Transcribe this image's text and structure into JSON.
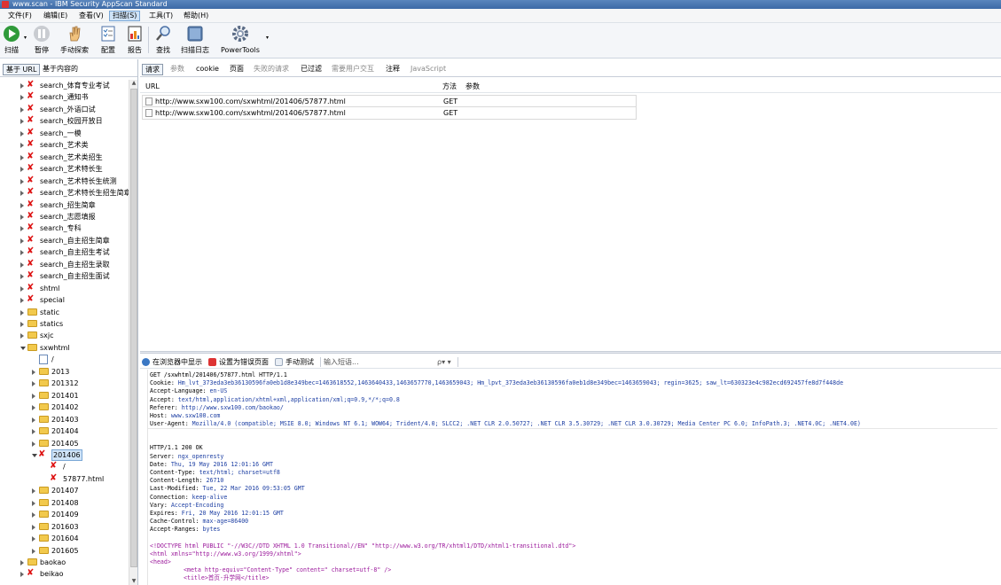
{
  "window": {
    "title": "www.scan - IBM Security AppScan Standard"
  },
  "menu": [
    "文件(F)",
    "编辑(E)",
    "查看(V)",
    "扫描(S)",
    "工具(T)",
    "帮助(H)"
  ],
  "toolbar": {
    "scan": "扫描",
    "pause": "暂停",
    "manual": "手动探索",
    "config": "配置",
    "report": "报告",
    "find": "查找",
    "log": "扫描日志",
    "powertools": "PowerTools"
  },
  "left_tabs": [
    "基于 URL",
    "基于内容的"
  ],
  "tree": [
    {
      "label": "search_体育专业考试",
      "icon": "bad",
      "exp": "closed",
      "indent": 1
    },
    {
      "label": "search_通知书",
      "icon": "bad",
      "exp": "closed",
      "indent": 1
    },
    {
      "label": "search_外语口试",
      "icon": "bad",
      "exp": "closed",
      "indent": 1
    },
    {
      "label": "search_校园开放日",
      "icon": "bad",
      "exp": "closed",
      "indent": 1
    },
    {
      "label": "search_一模",
      "icon": "bad",
      "exp": "closed",
      "indent": 1
    },
    {
      "label": "search_艺术类",
      "icon": "bad",
      "exp": "closed",
      "indent": 1
    },
    {
      "label": "search_艺术类招生",
      "icon": "bad",
      "exp": "closed",
      "indent": 1
    },
    {
      "label": "search_艺术特长生",
      "icon": "bad",
      "exp": "closed",
      "indent": 1
    },
    {
      "label": "search_艺术特长生统测",
      "icon": "bad",
      "exp": "closed",
      "indent": 1
    },
    {
      "label": "search_艺术特长生招生简章",
      "icon": "bad",
      "exp": "closed",
      "indent": 1
    },
    {
      "label": "search_招生简章",
      "icon": "bad",
      "exp": "closed",
      "indent": 1
    },
    {
      "label": "search_志愿填报",
      "icon": "bad",
      "exp": "closed",
      "indent": 1
    },
    {
      "label": "search_专科",
      "icon": "bad",
      "exp": "closed",
      "indent": 1
    },
    {
      "label": "search_自主招生简章",
      "icon": "bad",
      "exp": "closed",
      "indent": 1
    },
    {
      "label": "search_自主招生考试",
      "icon": "bad",
      "exp": "closed",
      "indent": 1
    },
    {
      "label": "search_自主招生录取",
      "icon": "bad",
      "exp": "closed",
      "indent": 1
    },
    {
      "label": "search_自主招生面试",
      "icon": "bad",
      "exp": "closed",
      "indent": 1
    },
    {
      "label": "shtml",
      "icon": "bad",
      "exp": "closed",
      "indent": 1
    },
    {
      "label": "special",
      "icon": "bad",
      "exp": "closed",
      "indent": 1
    },
    {
      "label": "static",
      "icon": "folder",
      "exp": "closed",
      "indent": 1
    },
    {
      "label": "statics",
      "icon": "folder",
      "exp": "closed",
      "indent": 1
    },
    {
      "label": "sxjc",
      "icon": "folder",
      "exp": "closed",
      "indent": 1
    },
    {
      "label": "sxwhtml",
      "icon": "folder",
      "exp": "open",
      "indent": 1
    },
    {
      "label": "/",
      "icon": "page",
      "exp": "none",
      "indent": 2
    },
    {
      "label": "2013",
      "icon": "folder",
      "exp": "closed",
      "indent": 2
    },
    {
      "label": "201312",
      "icon": "folder",
      "exp": "closed",
      "indent": 2
    },
    {
      "label": "201401",
      "icon": "folder",
      "exp": "closed",
      "indent": 2
    },
    {
      "label": "201402",
      "icon": "folder",
      "exp": "closed",
      "indent": 2
    },
    {
      "label": "201403",
      "icon": "folder",
      "exp": "closed",
      "indent": 2
    },
    {
      "label": "201404",
      "icon": "folder",
      "exp": "closed",
      "indent": 2
    },
    {
      "label": "201405",
      "icon": "folder",
      "exp": "closed",
      "indent": 2
    },
    {
      "label": "201406",
      "icon": "bad",
      "exp": "open",
      "indent": 2,
      "selected": true
    },
    {
      "label": "/",
      "icon": "bad",
      "exp": "none",
      "indent": 3
    },
    {
      "label": "57877.html",
      "icon": "bad",
      "exp": "none",
      "indent": 3
    },
    {
      "label": "201407",
      "icon": "folder",
      "exp": "closed",
      "indent": 2
    },
    {
      "label": "201408",
      "icon": "folder",
      "exp": "closed",
      "indent": 2
    },
    {
      "label": "201409",
      "icon": "folder",
      "exp": "closed",
      "indent": 2
    },
    {
      "label": "201603",
      "icon": "folder",
      "exp": "closed",
      "indent": 2
    },
    {
      "label": "201604",
      "icon": "folder",
      "exp": "closed",
      "indent": 2
    },
    {
      "label": "201605",
      "icon": "folder",
      "exp": "closed",
      "indent": 2
    },
    {
      "label": "baokao",
      "icon": "folder",
      "exp": "closed",
      "indent": 1
    },
    {
      "label": "beikao",
      "icon": "bad",
      "exp": "closed",
      "indent": 1
    }
  ],
  "right_tabs": [
    {
      "label": "请求",
      "selected": true
    },
    {
      "label": "参数",
      "dim": true
    },
    {
      "label": "cookie"
    },
    {
      "label": "页面"
    },
    {
      "label": "失败的请求",
      "dim": true
    },
    {
      "label": "已过滤"
    },
    {
      "label": "需要用户交互",
      "dim": true
    },
    {
      "label": "注释"
    },
    {
      "label": "JavaScript",
      "dim": true
    }
  ],
  "table": {
    "headers": [
      "URL",
      "方法",
      "参数"
    ],
    "rows": [
      {
        "url": "http://www.sxw100.com/sxwhtml/201406/57877.html",
        "method": "GET"
      },
      {
        "url": "http://www.sxw100.com/sxwhtml/201406/57877.html",
        "method": "GET"
      }
    ]
  },
  "detail_toolbar": {
    "show_browser": "在浏览器中显示",
    "set_error": "设置为错误页面",
    "manual_test": "手动测试",
    "search_placeholder": "输入短语...",
    "search_icon": "ρ▾ ▾"
  },
  "request_lines": [
    {
      "k": "GET /sxwhtml/201406/57877.html HTTP/1.1",
      "v": ""
    },
    {
      "k": "Cookie: ",
      "v": "Hm_lvt_373eda3eb36130596fa0eb1d8e349bec=1463618552,1463640433,1463657770,1463659043; Hm_lpvt_373eda3eb36130596fa0eb1d8e349bec=1463659043; regin=3625; saw_lt=630323e4c982ecd692457fe8d7f448de"
    },
    {
      "k": "Accept-Language: ",
      "v": "en-US"
    },
    {
      "k": "Accept: ",
      "v": "text/html,application/xhtml+xml,application/xml;q=0.9,*/*;q=0.8"
    },
    {
      "k": "Referer: ",
      "v": "http://www.sxw100.com/baokao/"
    },
    {
      "k": "Host: ",
      "v": "www.sxw100.com"
    },
    {
      "k": "User-Agent: ",
      "v": "Mozilla/4.0 (compatible; MSIE 8.0; Windows NT 6.1; WOW64; Trident/4.0; SLCC2; .NET CLR 2.0.50727; .NET CLR 3.5.30729; .NET CLR 3.0.30729; Media Center PC 6.0; InfoPath.3; .NET4.0C; .NET4.0E)"
    }
  ],
  "response_lines": [
    {
      "k": "HTTP/1.1 200 OK",
      "v": ""
    },
    {
      "k": "Server: ",
      "v": "ngx_openresty"
    },
    {
      "k": "Date: ",
      "v": "Thu, 19 May 2016 12:01:16 GMT"
    },
    {
      "k": "Content-Type: ",
      "v": "text/html; charset=utf8"
    },
    {
      "k": "Content-Length: ",
      "v": "26710"
    },
    {
      "k": "Last-Modified: ",
      "v": "Tue, 22 Mar 2016 09:53:05 GMT"
    },
    {
      "k": "Connection: ",
      "v": "keep-alive"
    },
    {
      "k": "Vary: ",
      "v": "Accept-Encoding"
    },
    {
      "k": "Expires: ",
      "v": "Fri, 20 May 2016 12:01:15 GMT"
    },
    {
      "k": "Cache-Control: ",
      "v": "max-age=86400"
    },
    {
      "k": "Accept-Ranges: ",
      "v": "bytes"
    }
  ],
  "html_lines": [
    "<!DOCTYPE html PUBLIC \"-//W3C//DTD XHTML 1.0 Transitional//EN\" \"http://www.w3.org/TR/xhtml1/DTD/xhtml1-transitional.dtd\">",
    "<html xmlns=\"http://www.w3.org/1999/xhtml\">",
    "<head>",
    "<meta http-equiv=\"Content-Type\" content=\" charset=utf-8\" />",
    "<title>首页-升学网</title>"
  ]
}
